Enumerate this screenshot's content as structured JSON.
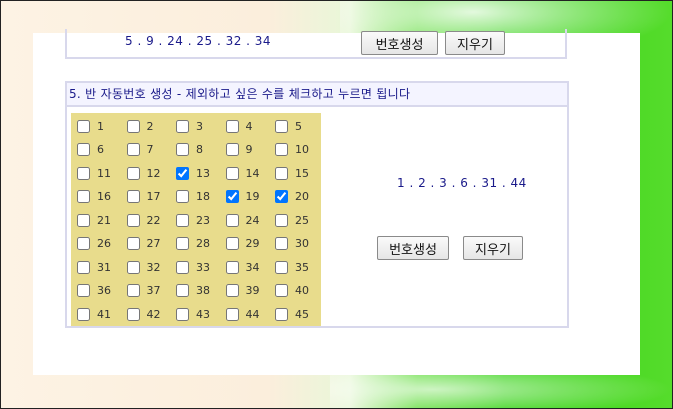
{
  "top_row": {
    "numbers": "5 . 9 . 24 . 25 . 32 . 34",
    "generate_label": "번호생성",
    "clear_label": "지우기"
  },
  "section5": {
    "title": "5. 반 자동번호 생성 - 제외하고 싶은 수를 체크하고 누르면 됩니다",
    "numbers": [
      1,
      2,
      3,
      4,
      5,
      6,
      7,
      8,
      9,
      10,
      11,
      12,
      13,
      14,
      15,
      16,
      17,
      18,
      19,
      20,
      21,
      22,
      23,
      24,
      25,
      26,
      27,
      28,
      29,
      30,
      31,
      32,
      33,
      34,
      35,
      36,
      37,
      38,
      39,
      40,
      41,
      42,
      43,
      44,
      45
    ],
    "checked": [
      13,
      19,
      20
    ],
    "result": "1 . 2 . 3 . 6 . 31 . 44",
    "generate_label": "번호생성",
    "clear_label": "지우기"
  }
}
